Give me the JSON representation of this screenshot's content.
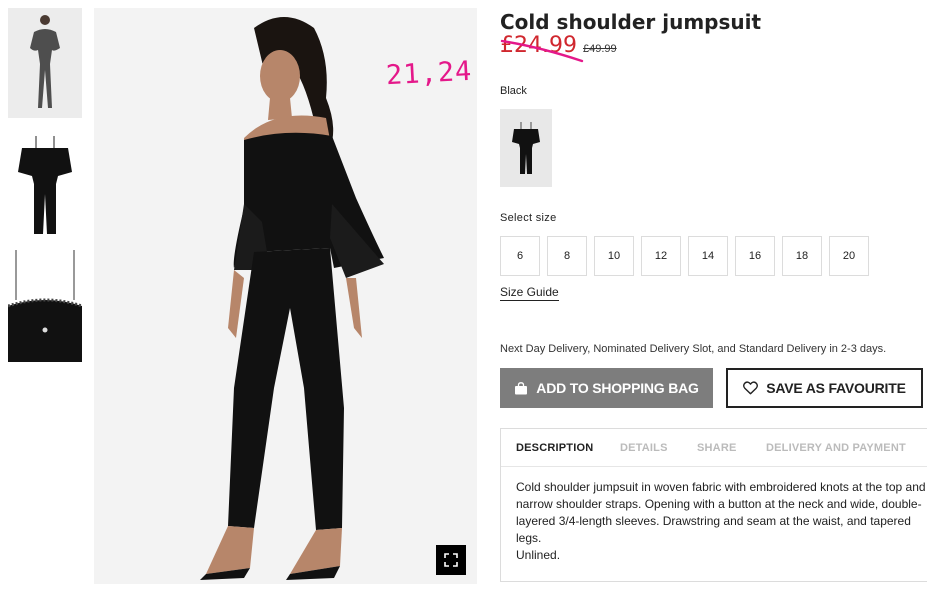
{
  "product": {
    "title": "Cold shoulder jumpsuit",
    "sale_price": "£24.99",
    "original_price": "£49.99",
    "handwritten_note": "21,24",
    "color_label": "Black"
  },
  "size_selector": {
    "label": "Select size",
    "sizes": [
      "6",
      "8",
      "10",
      "12",
      "14",
      "16",
      "18",
      "20"
    ],
    "guide_label": "Size Guide"
  },
  "delivery": {
    "note": "Next Day Delivery, Nominated Delivery Slot, and Standard Delivery in 2-3 days."
  },
  "actions": {
    "add_to_bag": "ADD TO SHOPPING BAG",
    "save_favourite": "SAVE AS FAVOURITE"
  },
  "tabs": {
    "items": [
      "DESCRIPTION",
      "DETAILS",
      "SHARE",
      "DELIVERY AND PAYMENT"
    ],
    "active": "DESCRIPTION",
    "description_text": "Cold shoulder jumpsuit in woven fabric with embroidered knots at the top and\nnarrow shoulder straps. Opening with a button at the neck and wide, double-\nlayered 3/4-length sleeves. Drawstring and seam at the waist, and tapered legs.\nUnlined."
  },
  "icons": {
    "fullscreen": "fullscreen-icon",
    "bag": "shopping-bag-icon",
    "heart": "heart-icon"
  },
  "colors": {
    "sale_red": "#d0272e",
    "annotation_pink": "#e4188a",
    "bag_button_gray": "#7d7d7d",
    "garment_black": "#111111"
  }
}
